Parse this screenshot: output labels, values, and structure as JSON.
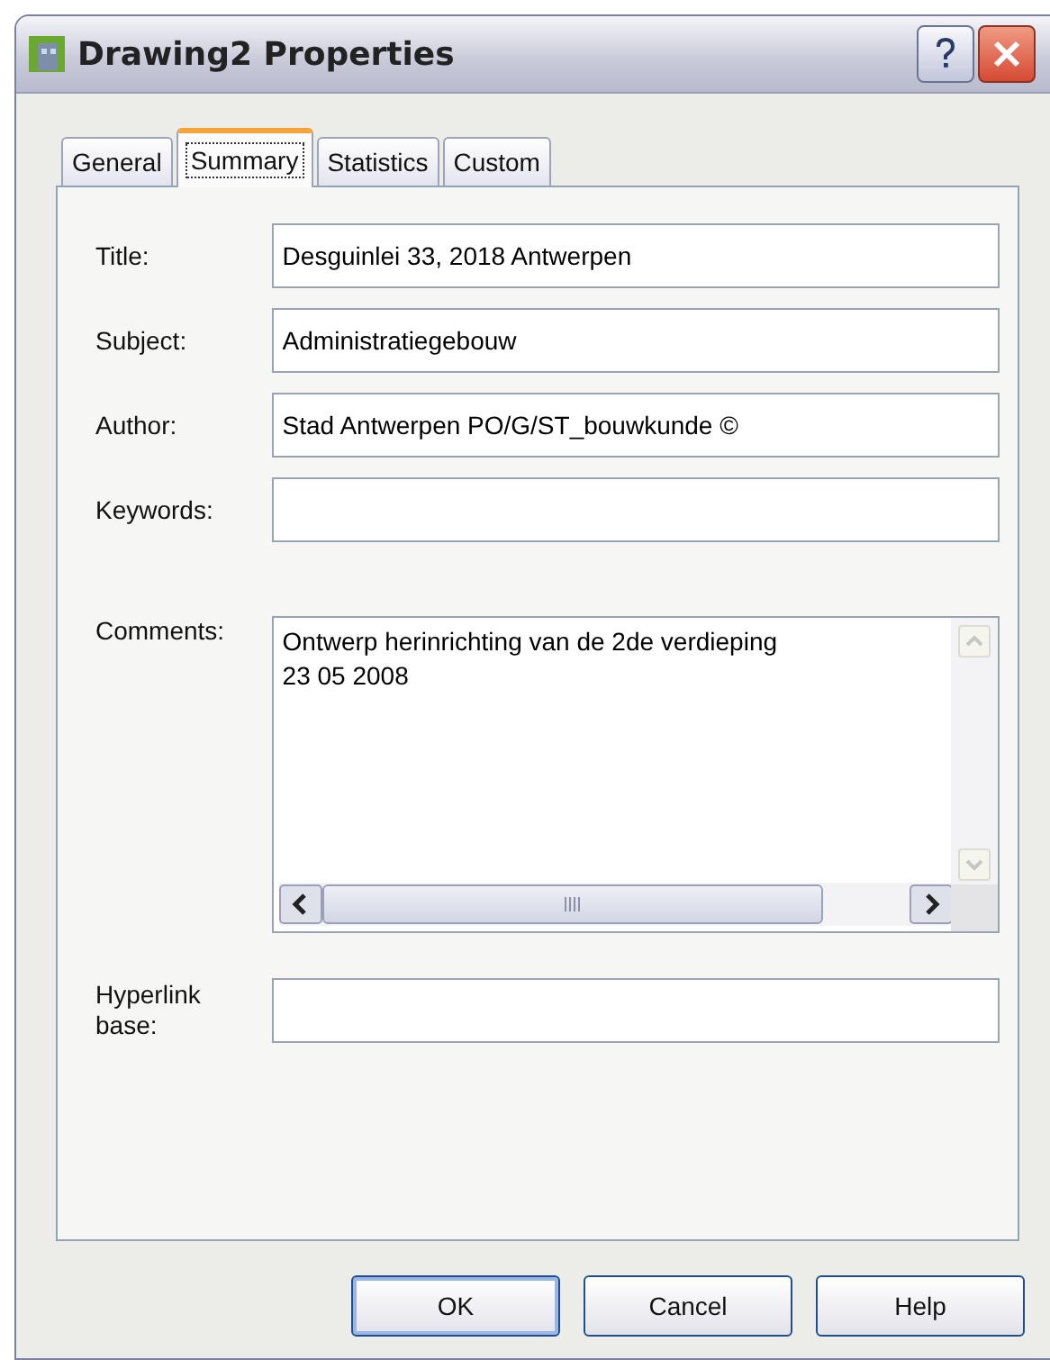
{
  "window": {
    "title": "Drawing2 Properties"
  },
  "tabs": [
    {
      "label": "General",
      "selected": false
    },
    {
      "label": "Summary",
      "selected": true
    },
    {
      "label": "Statistics",
      "selected": false
    },
    {
      "label": "Custom",
      "selected": false
    }
  ],
  "fields": [
    {
      "label": "Title:",
      "value": "Desguinlei 33, 2018 Antwerpen"
    },
    {
      "label": "Subject:",
      "value": "Administratiegebouw"
    },
    {
      "label": "Author:",
      "value": "Stad Antwerpen PO/G/ST_bouwkunde ©"
    },
    {
      "label": "Keywords:"
    }
  ],
  "comments": {
    "label": "Comments:",
    "lines": [
      "Ontwerp herinrichting van de 2de verdieping",
      "23 05 2008"
    ]
  },
  "hyperlink_base": {
    "label_lines": [
      "Hyperlink",
      "base:"
    ]
  },
  "buttons": [
    {
      "label": "OK",
      "default": true
    },
    {
      "label": "Cancel",
      "default": false
    },
    {
      "label": "Help",
      "default": false
    }
  ]
}
